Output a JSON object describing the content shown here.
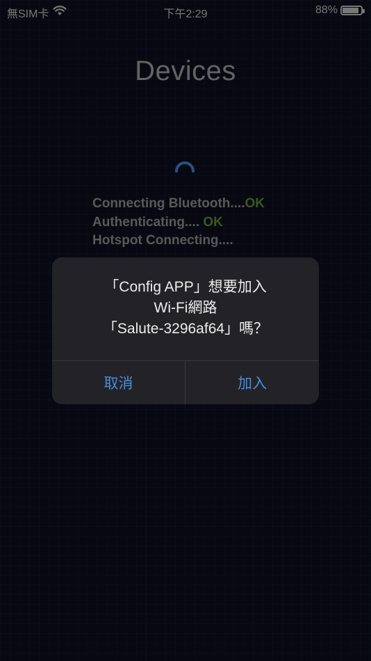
{
  "status_bar": {
    "carrier": "無SIM卡",
    "time": "下午2:29",
    "battery_percent_text": "88%",
    "battery_level": 0.88
  },
  "page": {
    "title": "Devices"
  },
  "progress_log": {
    "line1_text": "Connecting Bluetooth....",
    "line1_status": "OK",
    "line2_text": "Authenticating.... ",
    "line2_status": "OK",
    "line3_text": "Hotspot Connecting...."
  },
  "dialog": {
    "line1": "「Config APP」想要加入",
    "line2": "Wi-Fi網路",
    "line3": "「Salute-3296af64」嗎？",
    "cancel_label": "取消",
    "join_label": "加入"
  },
  "colors": {
    "accent": "#4a8be0",
    "ok": "#4f7a2a",
    "spinner": "#3d6fb0"
  }
}
